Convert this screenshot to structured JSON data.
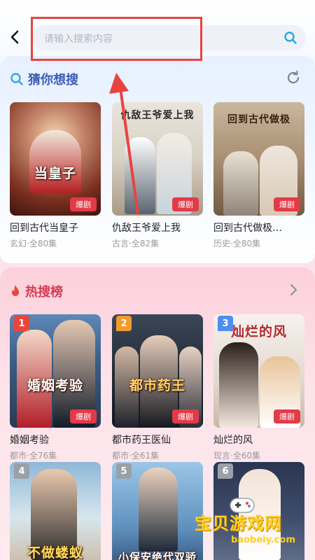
{
  "header": {
    "search": {
      "placeholder": "请输入搜索内容"
    }
  },
  "guess": {
    "title": "猜你想搜",
    "items": [
      {
        "title": "回到古代当皇子",
        "meta": "玄幻·全80集",
        "badge": "爆剧",
        "caption": "当皇子"
      },
      {
        "title": "仇敌王爷爱上我",
        "meta": "古言·全82集",
        "badge": "爆剧",
        "caption": "仇敌王爷爱上我"
      },
      {
        "title": "回到古代做极…",
        "meta": "历史·全80集",
        "badge": "爆剧",
        "caption": "回到古代做极"
      }
    ]
  },
  "hot": {
    "title": "热搜榜",
    "items": [
      {
        "rank": "1",
        "title": "婚姻考验",
        "meta": "都市·全76集",
        "badge": "爆剧",
        "caption": "婚姻考验"
      },
      {
        "rank": "2",
        "title": "都市药王医仙",
        "meta": "都市·全61集",
        "badge": "爆剧",
        "caption": "都市药王"
      },
      {
        "rank": "3",
        "title": "灿烂的风",
        "meta": "现言·全60集",
        "badge": "爆剧",
        "caption": "灿烂的风"
      },
      {
        "rank": "4",
        "caption": "不做蝼蚁"
      },
      {
        "rank": "5",
        "caption": "小保安绝代双骄"
      },
      {
        "rank": "6",
        "caption": ""
      }
    ]
  },
  "watermark": {
    "text": "宝贝游戏网",
    "url": "baobeiy.com"
  },
  "colors": {
    "rank1": "#e8463a",
    "rank2": "#f29a2e",
    "rank3": "#4d8ef0",
    "rank_other": "#9aa0a8",
    "badge": "#e33a48",
    "highlight": "#e8443f"
  }
}
